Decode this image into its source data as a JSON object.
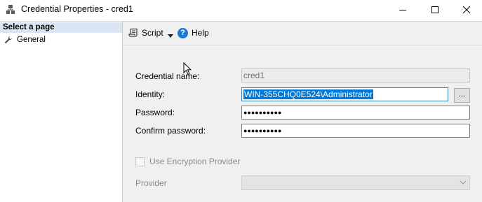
{
  "window": {
    "title": "Credential Properties - cred1"
  },
  "left_pane": {
    "header": "Select a page",
    "items": [
      {
        "label": "General",
        "icon": "wrench-icon"
      }
    ]
  },
  "toolbar": {
    "script_label": "Script",
    "help_label": "Help",
    "help_glyph": "?"
  },
  "form": {
    "credential_name": {
      "label": "Credential name:",
      "value": "cred1"
    },
    "identity": {
      "label": "Identity:",
      "value": "WIN-355CHQ0E524\\Administrator",
      "browse_label": "..."
    },
    "password": {
      "label": "Password:",
      "value": "●●●●●●●●●●"
    },
    "confirm_password": {
      "label": "Confirm password:",
      "value": "●●●●●●●●●●"
    },
    "use_encryption_provider": {
      "label": "Use Encryption Provider",
      "checked": false
    },
    "provider": {
      "label": "Provider",
      "value": ""
    }
  },
  "colors": {
    "selection": "#0078d7",
    "left_header_bg": "#dbe4f2",
    "help_icon": "#1d79d6",
    "pane_bg": "#f0f0f0"
  }
}
